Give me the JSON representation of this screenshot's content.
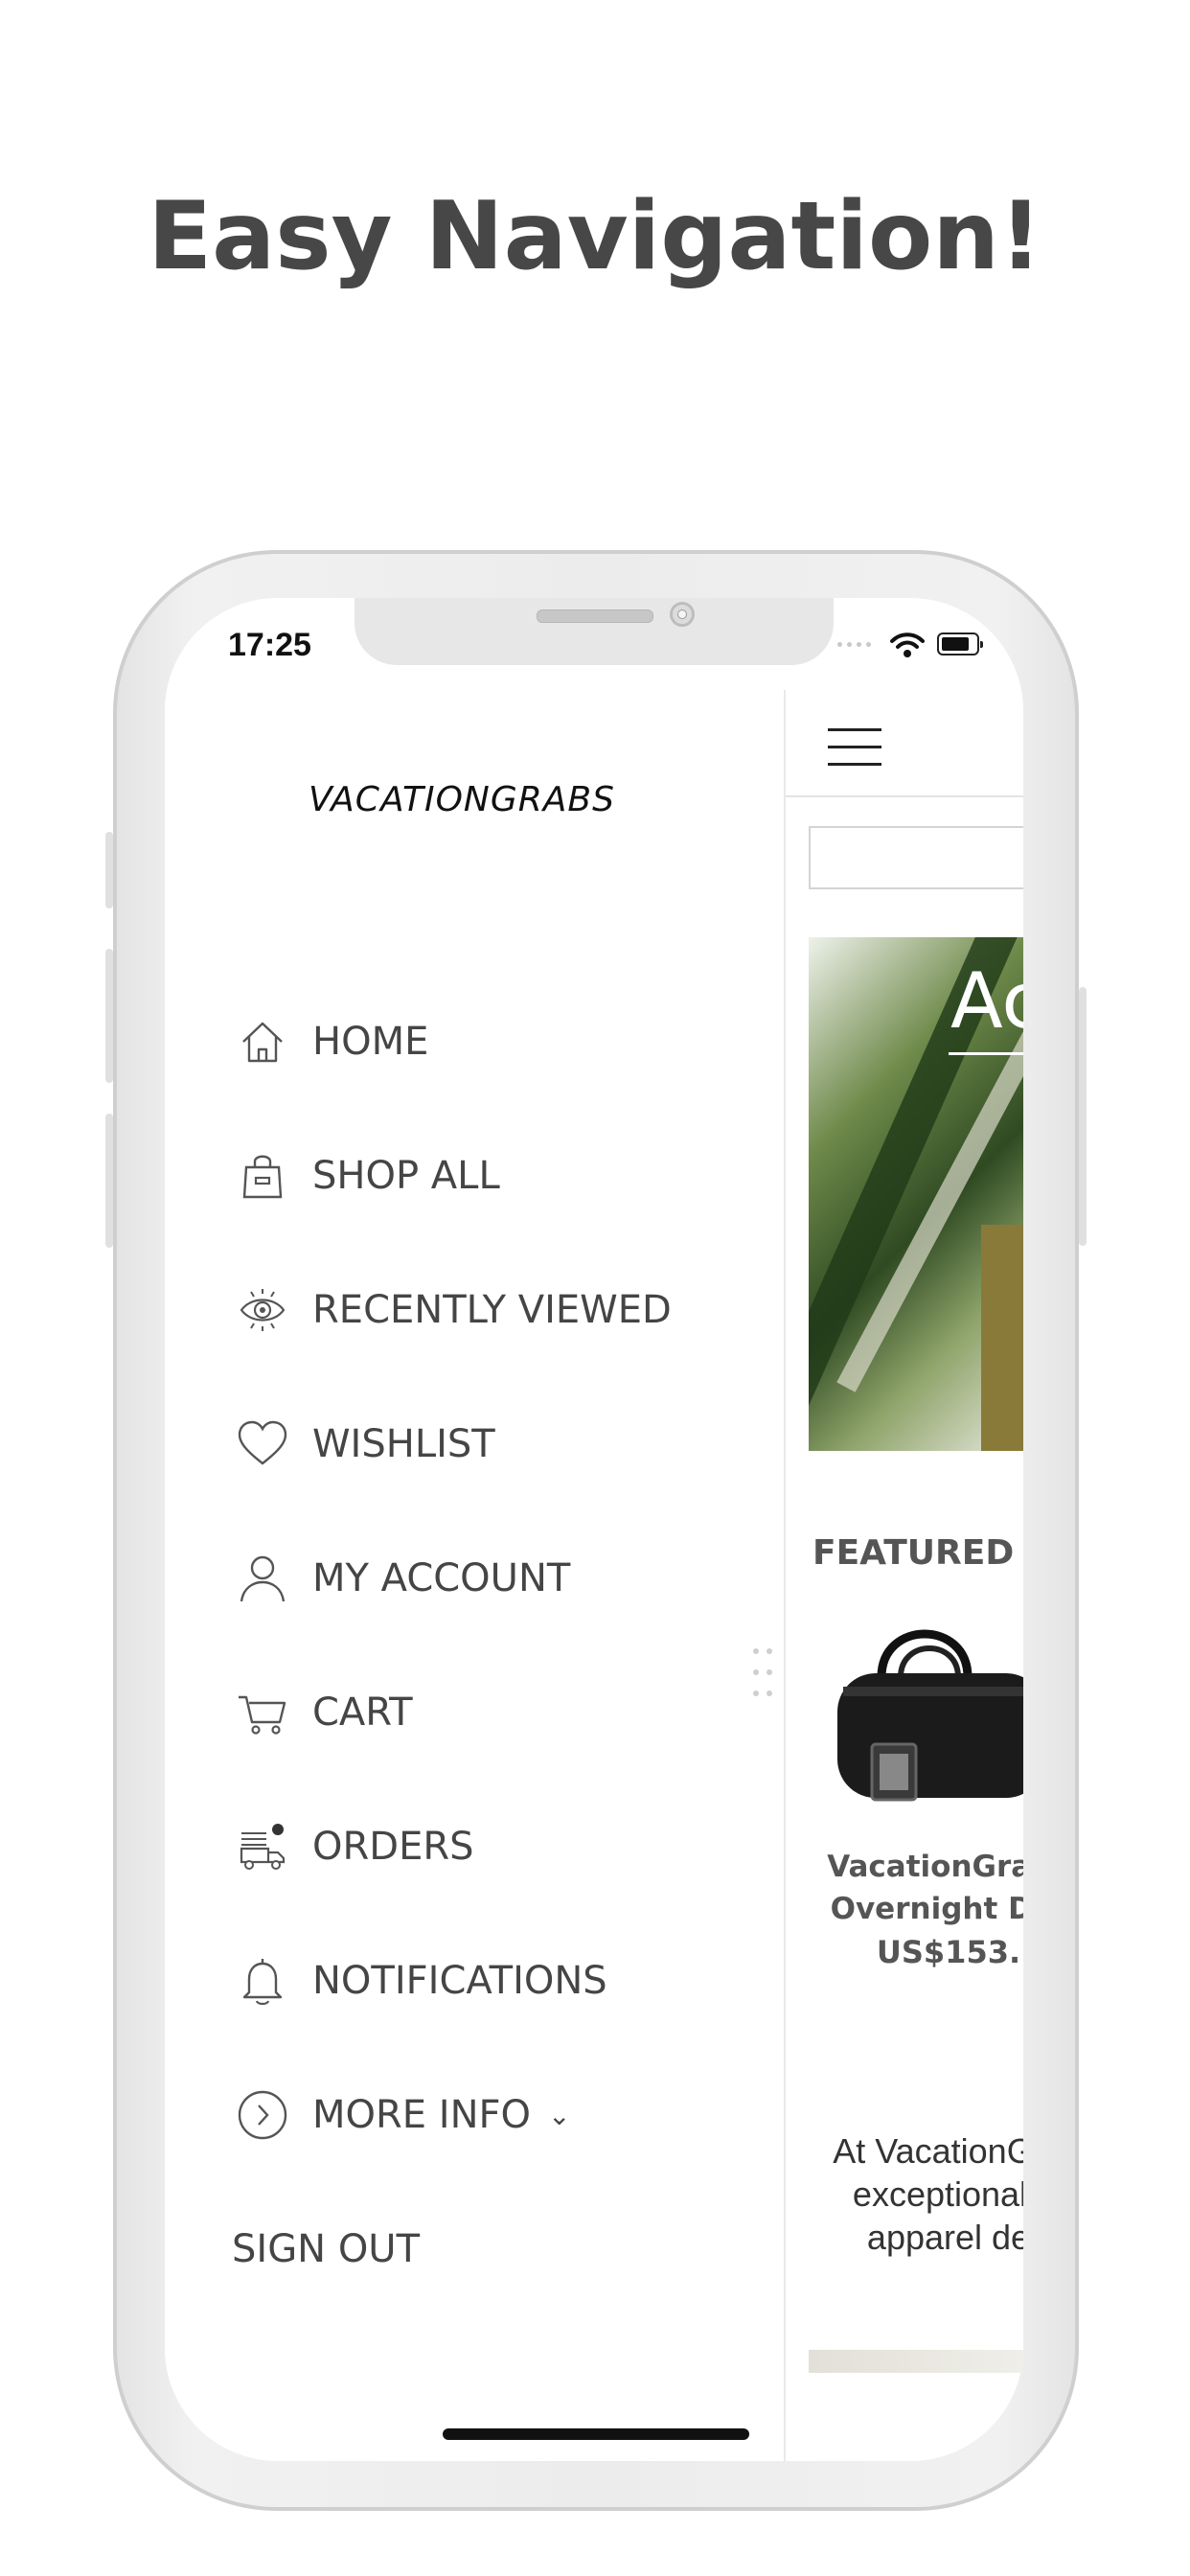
{
  "headline": "Easy Navigation!",
  "status_bar": {
    "time": "17:25"
  },
  "drawer": {
    "logo": "VACATIONGRABS",
    "items": [
      {
        "label": "HOME",
        "icon": "home-icon"
      },
      {
        "label": "SHOP ALL",
        "icon": "shopping-bag-icon"
      },
      {
        "label": "RECENTLY VIEWED",
        "icon": "eye-icon"
      },
      {
        "label": "WISHLIST",
        "icon": "heart-icon"
      },
      {
        "label": "MY ACCOUNT",
        "icon": "user-icon"
      },
      {
        "label": "CART",
        "icon": "cart-icon"
      },
      {
        "label": "ORDERS",
        "icon": "delivery-truck-icon"
      },
      {
        "label": "NOTIFICATIONS",
        "icon": "bell-icon"
      },
      {
        "label": "MORE INFO",
        "icon": "chevron-right-circle-icon"
      }
    ],
    "more_info_chevron": "⌄",
    "sign_out": "SIGN OUT"
  },
  "page": {
    "hero_text": "Ac",
    "featured_heading": "FEATURED P",
    "product": {
      "name_line1": "VacationGrabs",
      "name_line2": "Overnight Duf",
      "price": "US$153."
    },
    "about_line1": "At VacationGra",
    "about_line2": "exceptional l",
    "about_line3": "apparel de"
  }
}
